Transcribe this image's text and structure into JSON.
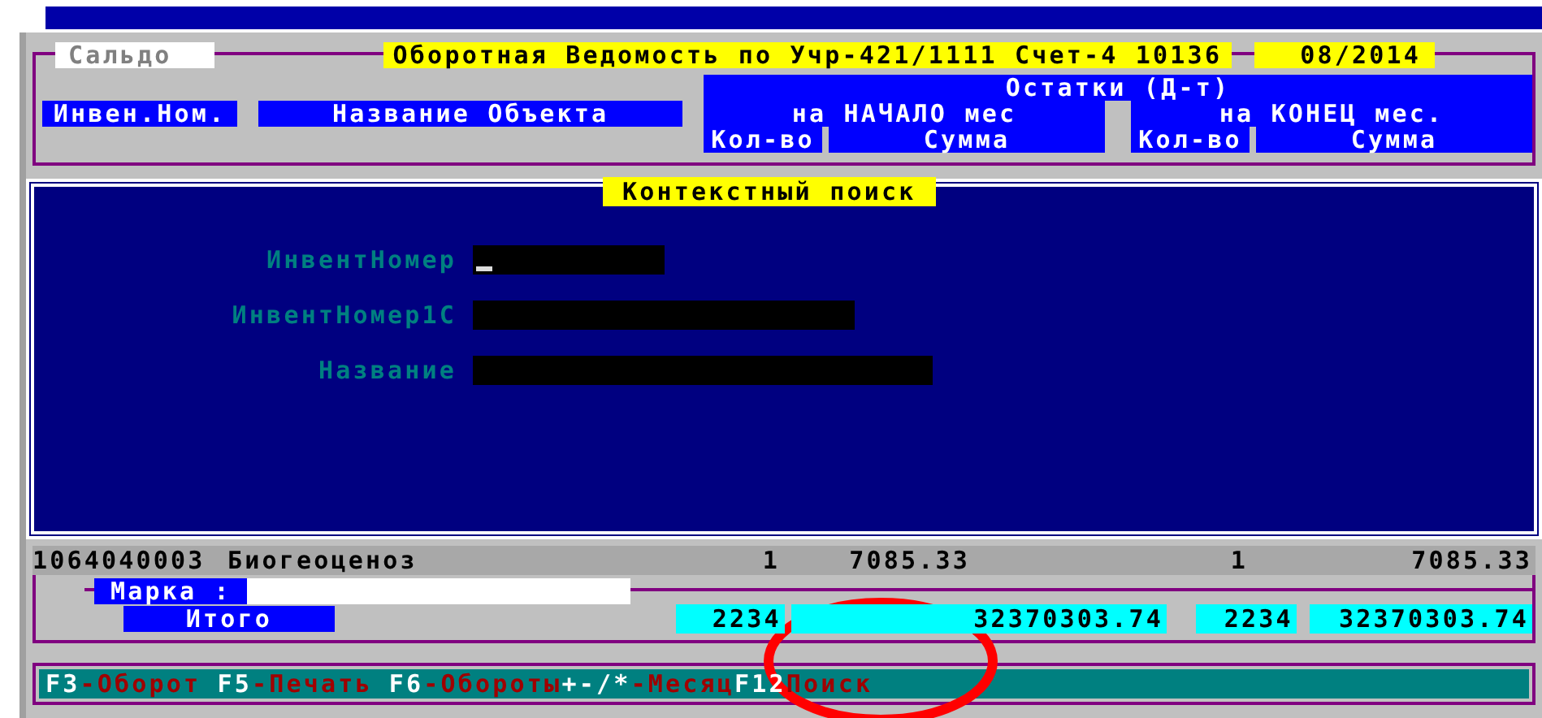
{
  "tab": {
    "label": "Сальдо"
  },
  "title": "Оборотная Ведомость по Учр-421/1111  Счет-4 10136",
  "period": "08/2014",
  "columns": [
    {
      "label": "Инвен.Ном."
    },
    {
      "label": "Название Объекта"
    }
  ],
  "balance": {
    "label": "Остатки (Д-т)",
    "groups": [
      {
        "label": "на НАЧАЛО мес",
        "qty": "Кол-во",
        "sum": "Сумма"
      },
      {
        "label": "на КОНЕЦ мес.",
        "qty": "Кол-во",
        "sum": "Сумма"
      }
    ]
  },
  "dialog": {
    "title": "Контекстный поиск",
    "fields": [
      {
        "label": "ИнвентНомер",
        "focused": true
      },
      {
        "label": "ИнвентНомер1С",
        "focused": false
      },
      {
        "label": "Название",
        "focused": false
      }
    ]
  },
  "row": {
    "inventory": "1064040003",
    "name": "Биогеоценоз",
    "values": [
      "1",
      "7085.33",
      "1",
      "7085.33"
    ]
  },
  "brand": {
    "label": "Марка :"
  },
  "total": {
    "label": "Итого",
    "values": [
      "2234",
      "32370303.74",
      "2234",
      "32370303.74"
    ]
  },
  "hotkeys": [
    {
      "key": "F3",
      "action": "-Оборот"
    },
    {
      "key": "F5",
      "action": "-Печать"
    },
    {
      "key": "F6",
      "action": "-Обороты"
    },
    {
      "key": "+-/*",
      "action": "-Месяц"
    },
    {
      "key": "F12",
      "action": "Поиск"
    }
  ]
}
